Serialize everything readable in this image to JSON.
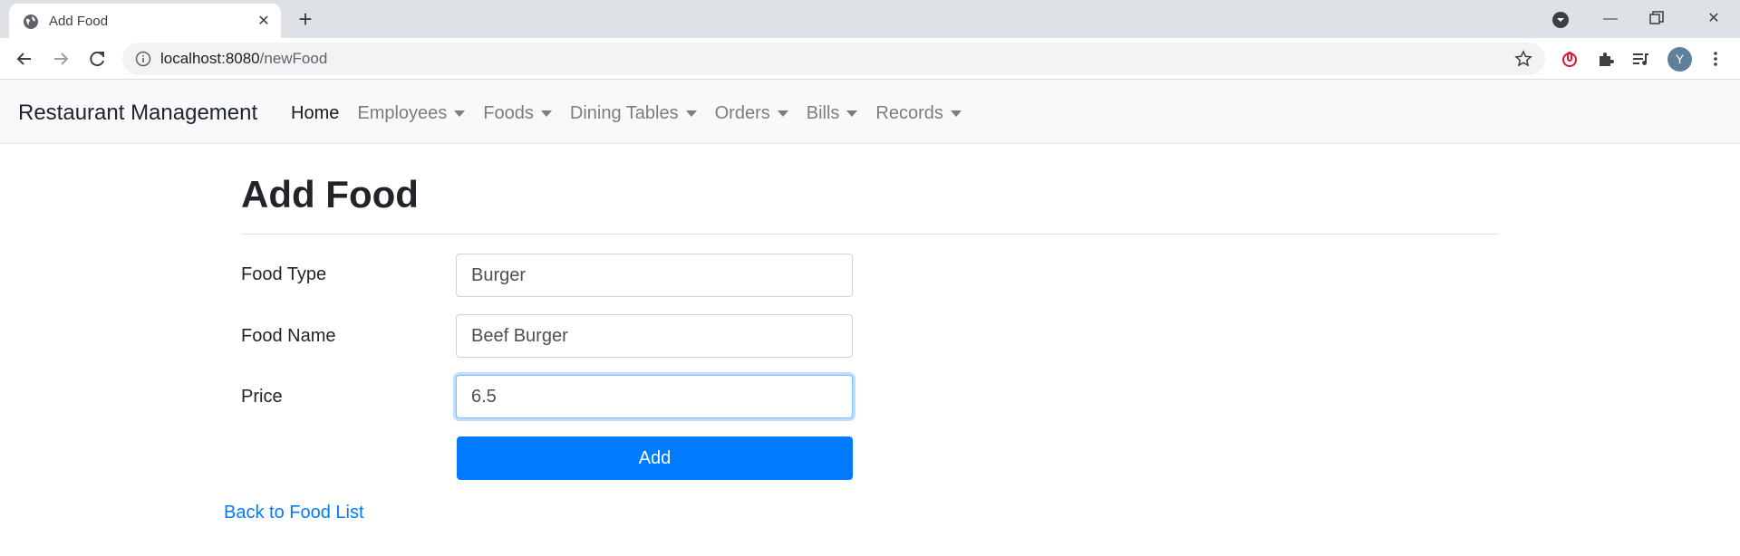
{
  "browser": {
    "tab_title": "Add Food",
    "url_host": "localhost:8080",
    "url_path": "/newFood",
    "profile_initial": "Y",
    "icons": [
      "globe-icon",
      "close-icon",
      "plus-icon",
      "tab-search-icon",
      "minimize-icon",
      "restore-icon",
      "window-close-icon",
      "back-arrow-icon",
      "forward-arrow-icon",
      "reload-icon",
      "info-icon",
      "star-icon",
      "lock-extension-icon",
      "puzzle-icon",
      "media-queue-icon",
      "kebab-menu-icon"
    ]
  },
  "navbar": {
    "brand": "Restaurant Management",
    "items": [
      {
        "label": "Home",
        "dropdown": false,
        "active": true
      },
      {
        "label": "Employees",
        "dropdown": true,
        "active": false
      },
      {
        "label": "Foods",
        "dropdown": true,
        "active": false
      },
      {
        "label": "Dining Tables",
        "dropdown": true,
        "active": false
      },
      {
        "label": "Orders",
        "dropdown": true,
        "active": false
      },
      {
        "label": "Bills",
        "dropdown": true,
        "active": false
      },
      {
        "label": "Records",
        "dropdown": true,
        "active": false
      }
    ]
  },
  "page": {
    "title": "Add Food",
    "fields": {
      "food_type": {
        "label": "Food Type",
        "value": "Burger"
      },
      "food_name": {
        "label": "Food Name",
        "value": "Beef Burger"
      },
      "price": {
        "label": "Price",
        "value": "6.5"
      }
    },
    "submit_label": "Add",
    "back_link": "Back to Food List"
  },
  "colors": {
    "primary": "#007bff",
    "navbar_bg": "#f8f9fa",
    "text": "#212529",
    "focus_border": "#80bdff"
  }
}
